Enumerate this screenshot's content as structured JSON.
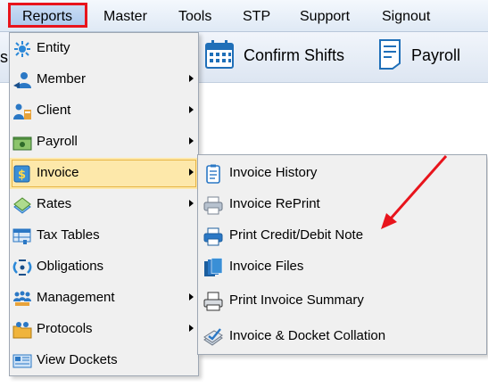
{
  "menubar": {
    "items": [
      {
        "label": "Reports"
      },
      {
        "label": "Master"
      },
      {
        "label": "Tools"
      },
      {
        "label": "STP"
      },
      {
        "label": "Support"
      },
      {
        "label": "Signout"
      }
    ]
  },
  "toolbar": {
    "partial_label": "s",
    "confirm_shifts_label": "Confirm Shifts",
    "payroll_label": "Payroll"
  },
  "reports_menu": {
    "items": [
      {
        "label": "Entity",
        "icon": "entity-icon",
        "submenu": false
      },
      {
        "label": "Member",
        "icon": "member-icon",
        "submenu": true
      },
      {
        "label": "Client",
        "icon": "client-icon",
        "submenu": true
      },
      {
        "label": "Payroll",
        "icon": "payroll-icon",
        "submenu": true
      },
      {
        "label": "Invoice",
        "icon": "invoice-icon",
        "submenu": true,
        "highlighted": true
      },
      {
        "label": "Rates",
        "icon": "rates-icon",
        "submenu": true
      },
      {
        "label": "Tax Tables",
        "icon": "tax-tables-icon",
        "submenu": false
      },
      {
        "label": "Obligations",
        "icon": "obligations-icon",
        "submenu": false
      },
      {
        "label": "Management",
        "icon": "management-icon",
        "submenu": true
      },
      {
        "label": "Protocols",
        "icon": "protocols-icon",
        "submenu": true
      },
      {
        "label": "View Dockets",
        "icon": "view-dockets-icon",
        "submenu": false
      }
    ]
  },
  "invoice_submenu": {
    "items": [
      {
        "label": "Invoice History",
        "icon": "invoice-history-icon"
      },
      {
        "label": "Invoice RePrint",
        "icon": "printer-icon"
      },
      {
        "label": "Print Credit/Debit Note",
        "icon": "printer-icon"
      },
      {
        "label": "Invoice Files",
        "icon": "invoice-files-icon"
      },
      {
        "label": "Print Invoice Summary",
        "icon": "print-summary-icon"
      },
      {
        "label": "Invoice & Docket Collation",
        "icon": "collation-icon"
      }
    ]
  },
  "colors": {
    "highlight_border": "#e8141c",
    "menu_highlight": "#fde8aa",
    "arrow": "#e8141c",
    "icon_blue": "#2b78c5"
  }
}
